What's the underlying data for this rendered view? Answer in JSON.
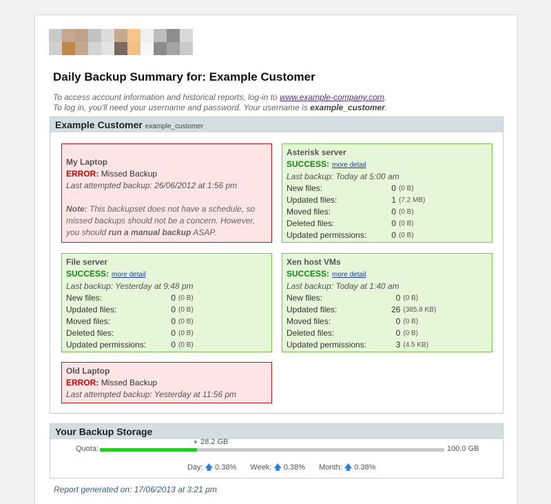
{
  "header": {
    "title": "Daily Backup Summary for: Example Customer",
    "intro_line1_prefix": "To access account information and historical reports, log-in to ",
    "intro_link": "www.example-company.com",
    "intro_line1_suffix": ".",
    "intro_line2_prefix": "To log in, you'll need your username and password. Your username is ",
    "intro_username": "example_customer",
    "intro_line2_suffix": "."
  },
  "colors": {
    "error_border": "#cc1111",
    "error_bg": "#fde5e5",
    "success_border": "#77c24c",
    "success_bg": "#e6f7d9",
    "quota_bar": "#22cc22",
    "section_header": "#d3dde2"
  },
  "customer": {
    "name": "Example Customer",
    "username": "example_customer"
  },
  "boxes": [
    {
      "name": "My Laptop",
      "status_label": "ERROR:",
      "status_text": "Missed Backup",
      "last": "Last attempted backup: 26/06/2012 at 1:56 pm",
      "note_label": "Note:",
      "note_text": " This backupset does not have a schedule, so missed backups should not be a concern. However, you should ",
      "note_bold": "run a manual backup",
      "note_end": " ASAP."
    },
    {
      "name": "Asterisk server",
      "status_label": "SUCCESS:",
      "detail_link": "more detail",
      "last": "Last backup: Today at 5:00 am",
      "rows": [
        {
          "label": "New files:",
          "value": "0",
          "size": "(0 B)"
        },
        {
          "label": "Updated files:",
          "value": "1",
          "size": "(7.2 MB)"
        },
        {
          "label": "Moved files:",
          "value": "0",
          "size": "(0 B)"
        },
        {
          "label": "Deleted files:",
          "value": "0",
          "size": "(0 B)"
        },
        {
          "label": "Updated permissions:",
          "value": "0",
          "size": "(0 B)"
        }
      ]
    },
    {
      "name": "File server",
      "status_label": "SUCCESS:",
      "detail_link": "more detail",
      "last": "Last backup: Yesterday at 9:48 pm",
      "rows": [
        {
          "label": "New files:",
          "value": "0",
          "size": "(0 B)"
        },
        {
          "label": "Updated files:",
          "value": "0",
          "size": "(0 B)"
        },
        {
          "label": "Moved files:",
          "value": "0",
          "size": "(0 B)"
        },
        {
          "label": "Deleted files:",
          "value": "0",
          "size": "(0 B)"
        },
        {
          "label": "Updated permissions:",
          "value": "0",
          "size": "(0 B)"
        }
      ]
    },
    {
      "name": "Xen host VMs",
      "status_label": "SUCCESS:",
      "detail_link": "more detail",
      "last": "Last backup: Today at 1:40 am",
      "rows": [
        {
          "label": "New files:",
          "value": "0",
          "size": "(0 B)"
        },
        {
          "label": "Updated files:",
          "value": "26",
          "size": "(385.8 KB)"
        },
        {
          "label": "Moved files:",
          "value": "0",
          "size": "(0 B)"
        },
        {
          "label": "Deleted files:",
          "value": "0",
          "size": "(0 B)"
        },
        {
          "label": "Updated permissions:",
          "value": "3",
          "size": "(4.5 KB)"
        }
      ]
    },
    {
      "name": "Old Laptop",
      "status_label": "ERROR:",
      "status_text": "Missed Backup",
      "last": "Last attempted backup: Yesterday at 11:56 pm"
    }
  ],
  "storage": {
    "title": "Your Backup Storage",
    "quota_label": "Quota:",
    "used_label": "28.2 GB",
    "total_label": "100.0 GB",
    "used_fraction": 0.282,
    "day_label": "Day:",
    "day_value": "0.38%",
    "week_label": "Week:",
    "week_value": "0.38%",
    "month_label": "Month:",
    "month_value": "0.38%",
    "trend_icon": "up-arrow-icon"
  },
  "footer": {
    "report": "Report generated on: 17/06/2013 at 3:21 pm"
  }
}
